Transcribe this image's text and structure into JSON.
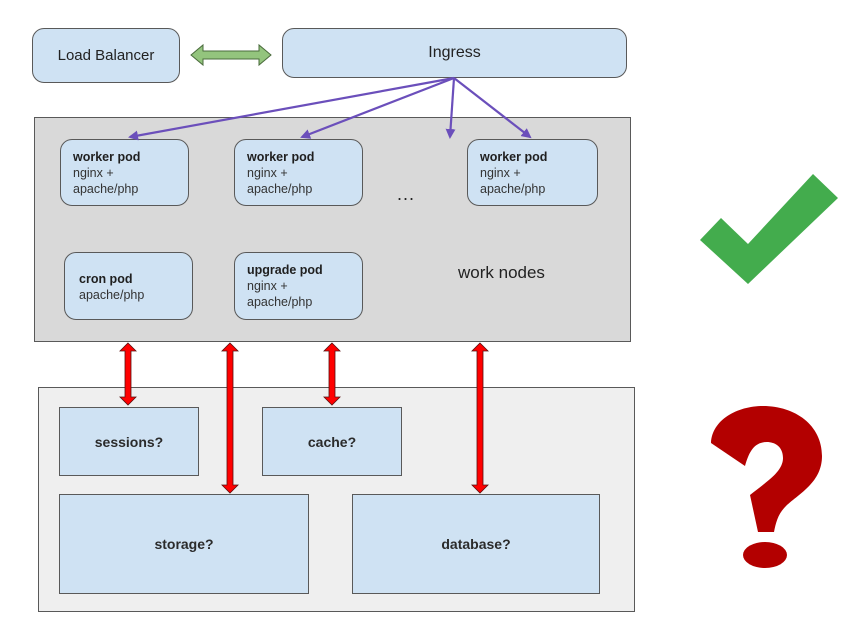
{
  "top": {
    "load_balancer": "Load Balancer",
    "ingress": "Ingress"
  },
  "work_nodes": {
    "label": "work nodes",
    "ellipsis": "...",
    "pods": [
      {
        "title": "worker pod",
        "lines": [
          "nginx +",
          "apache/php"
        ]
      },
      {
        "title": "worker pod",
        "lines": [
          "nginx +",
          "apache/php"
        ]
      },
      {
        "title": "worker pod",
        "lines": [
          "nginx +",
          "apache/php"
        ]
      },
      {
        "title": "cron pod",
        "lines": [
          "apache/php"
        ]
      },
      {
        "title": "upgrade pod",
        "lines": [
          "nginx +",
          "apache/php"
        ]
      }
    ]
  },
  "storage_layer": {
    "items": [
      "sessions?",
      "cache?",
      "storage?",
      "database?"
    ]
  },
  "status_icons": {
    "work_nodes_status": "check-mark-icon",
    "storage_status": "question-mark-icon"
  },
  "colors": {
    "node_fill": "#cfe2f3",
    "work_panel": "#d9d9d9",
    "store_panel": "#efefef",
    "ingress_arrows": "#6b4fbb",
    "data_arrows": "#ff0000",
    "lb_arrow": "#93c47d",
    "check": "#43ac4d",
    "question": "#b30000"
  }
}
